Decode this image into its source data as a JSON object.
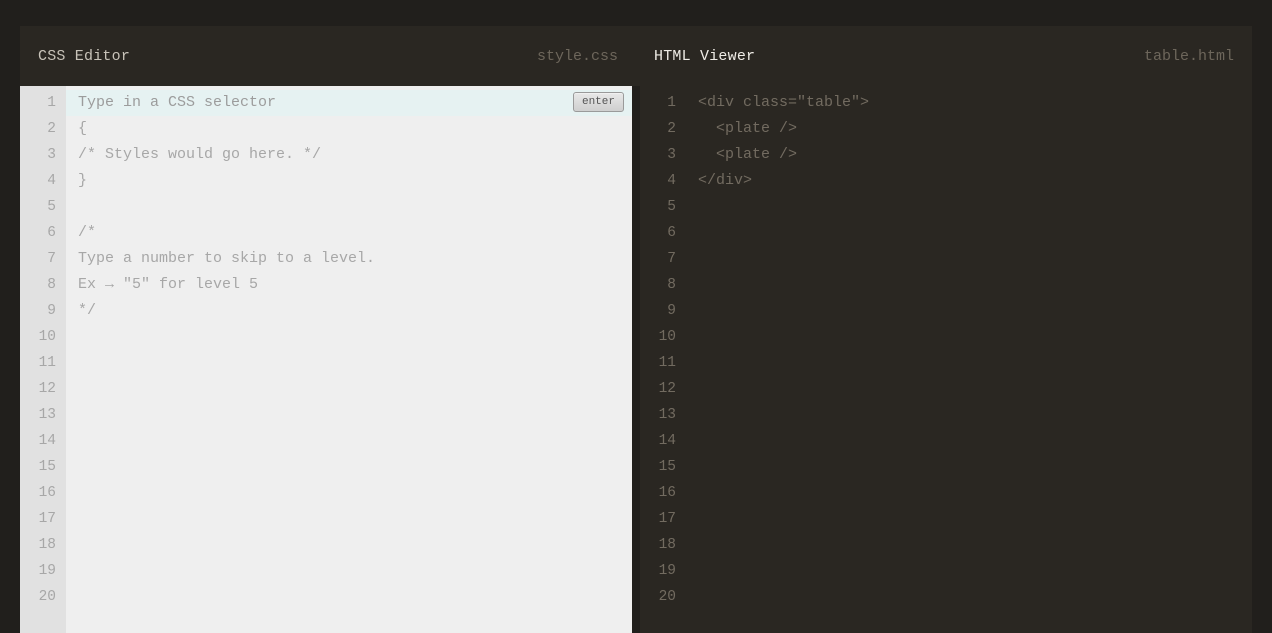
{
  "header": {
    "left_title": "CSS Editor",
    "left_file": "style.css",
    "right_title": "HTML Viewer",
    "right_file": "table.html"
  },
  "enter_button_label": "enter",
  "line_count": 20,
  "css_lines": [
    "Type in a CSS selector",
    "{",
    "/* Styles would go here. */",
    "}",
    "",
    "/*",
    "Type a number to skip to a level.",
    "Ex → \"5\" for level 5",
    "*/"
  ],
  "html_lines": [
    "<div class=\"table\">",
    "  <plate />",
    "  <plate />",
    "</div>"
  ]
}
